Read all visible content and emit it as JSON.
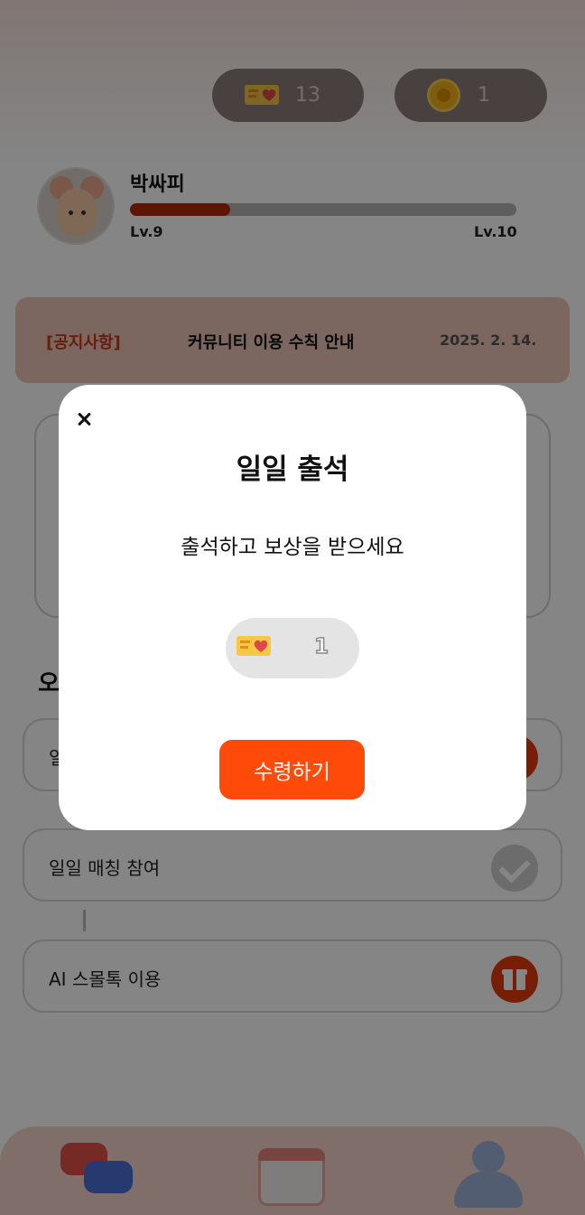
{
  "header": {
    "tickets_count": "13",
    "coins_count": "1"
  },
  "profile": {
    "nickname": "박싸피",
    "level_current": "Lv.9",
    "level_next": "Lv.10",
    "xp_progress_fraction": 0.26
  },
  "notice": {
    "tag": "[공지사항]",
    "title": "커뮤니티 이용 수칙 안내",
    "date": "2025. 2. 14."
  },
  "missions": {
    "section_title_partial": "오",
    "items": [
      {
        "label": "일",
        "state": "reward"
      },
      {
        "label": "일일 매칭 참여",
        "state": "completed"
      },
      {
        "label": "AI 스몰톡 이용",
        "state": "reward"
      }
    ]
  },
  "modal": {
    "title": "일일 출석",
    "description": "출석하고 보상을 받으세요",
    "reward_count": "1",
    "claim_label": "수령하기"
  },
  "icons": {
    "ticket": "heart-ticket-icon",
    "coin": "coin-icon",
    "close": "close-icon",
    "check": "check-icon",
    "gift": "gift-icon",
    "chat": "chat-bubbles-icon",
    "calendar": "calendar-icon",
    "profile": "profile-icon"
  },
  "colors": {
    "accent": "#ff4a0a",
    "notice_tag": "#c7381a",
    "xp_fill": "#b5290a"
  }
}
